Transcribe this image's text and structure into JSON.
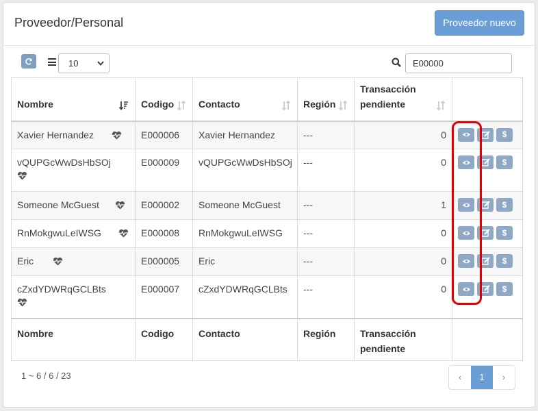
{
  "header": {
    "title": "Proveedor/Personal",
    "new_button": "Proveedor nuevo"
  },
  "toolbar": {
    "page_size": "10",
    "search_value": "E00000"
  },
  "table": {
    "columns": [
      "Nombre",
      "Codigo",
      "Contacto",
      "Región",
      "Transacción pendiente"
    ],
    "rows": [
      {
        "nombre": "Xavier Hernandez",
        "codigo": "E000006",
        "contacto": "Xavier Hernandez",
        "region": "---",
        "pendiente": "0"
      },
      {
        "nombre": "vQUPGcWwDsHbSOj",
        "codigo": "E000009",
        "contacto": "vQUPGcWwDsHbSOj",
        "region": "---",
        "pendiente": "0"
      },
      {
        "nombre": "Someone McGuest",
        "codigo": "E000002",
        "contacto": "Someone McGuest",
        "region": "---",
        "pendiente": "1"
      },
      {
        "nombre": "RnMokgwuLeIWSG",
        "codigo": "E000008",
        "contacto": "RnMokgwuLeIWSG",
        "region": "---",
        "pendiente": "0"
      },
      {
        "nombre": "Eric",
        "codigo": "E000005",
        "contacto": "Eric",
        "region": "---",
        "pendiente": "0"
      },
      {
        "nombre": "cZxdYDWRqGCLBts",
        "codigo": "E000007",
        "contacto": "cZxdYDWRqGCLBts",
        "region": "---",
        "pendiente": "0"
      }
    ],
    "action_icons": [
      "view-icon",
      "edit-icon",
      "dollar-icon"
    ],
    "dollar_label": "$"
  },
  "footer": {
    "page_info": "1 ~ 6 / 6 / 23",
    "prev": "‹",
    "current_page": "1",
    "next": "›"
  },
  "colors": {
    "accent": "#6b9ed6",
    "action_button": "#8ea8c6",
    "highlight": "#e00000"
  }
}
